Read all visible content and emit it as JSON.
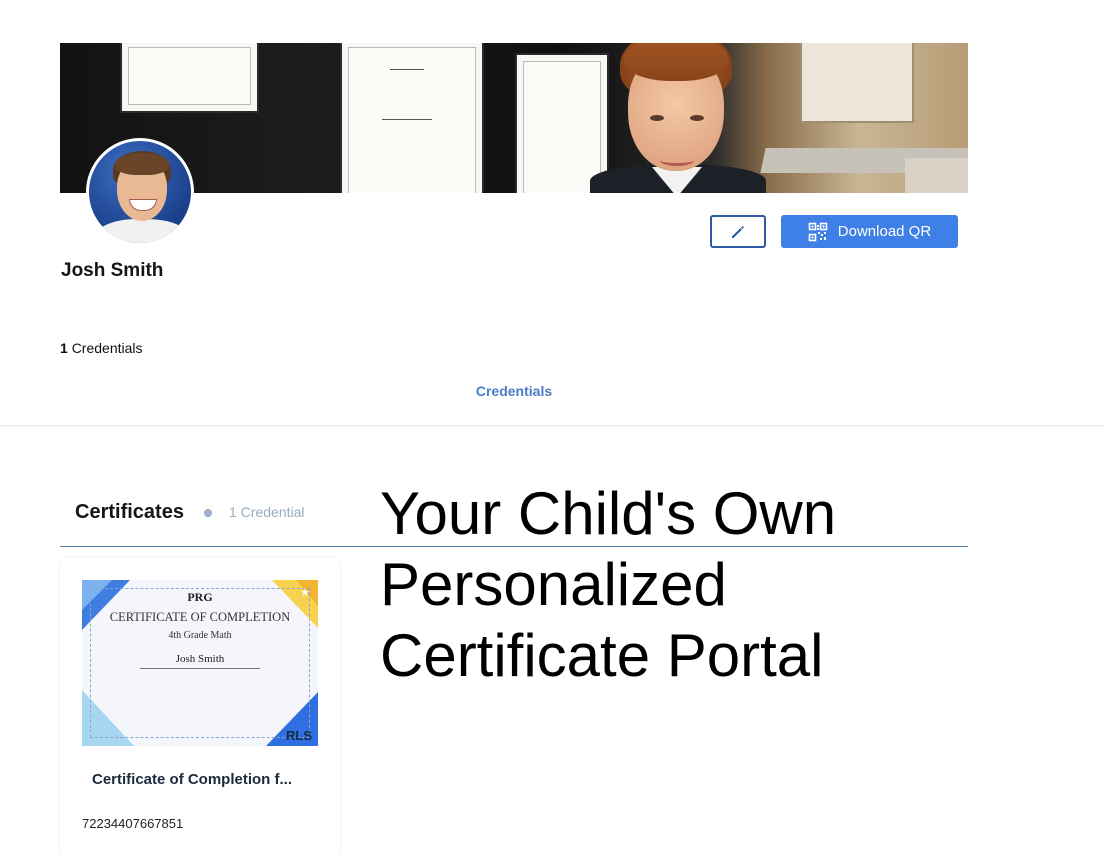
{
  "profile": {
    "name": "Josh Smith",
    "credentials_count": "1",
    "credentials_label": "Credentials"
  },
  "actions": {
    "edit_icon": "pencil-icon",
    "download_qr_label": "Download QR",
    "qr_icon": "qr-code-icon"
  },
  "tabs": [
    {
      "label": "Credentials",
      "active": true
    }
  ],
  "section": {
    "title": "Certificates",
    "subtitle": "1 Credential"
  },
  "overlay_text": [
    "Your Child's Own",
    "Personalized",
    "Certificate Portal"
  ],
  "card": {
    "title": "Certificate of Completion f...",
    "id": "72234407667851",
    "certificate": {
      "logo": "PRG",
      "heading": "CERTIFICATE OF COMPLETION",
      "subject": "4th Grade Math",
      "recipient": "Josh Smith",
      "brand": "RLS"
    }
  },
  "colors": {
    "accent": "#3f80e6",
    "tab_text": "#4a7cc4",
    "section_rule": "#4f7fa8"
  }
}
